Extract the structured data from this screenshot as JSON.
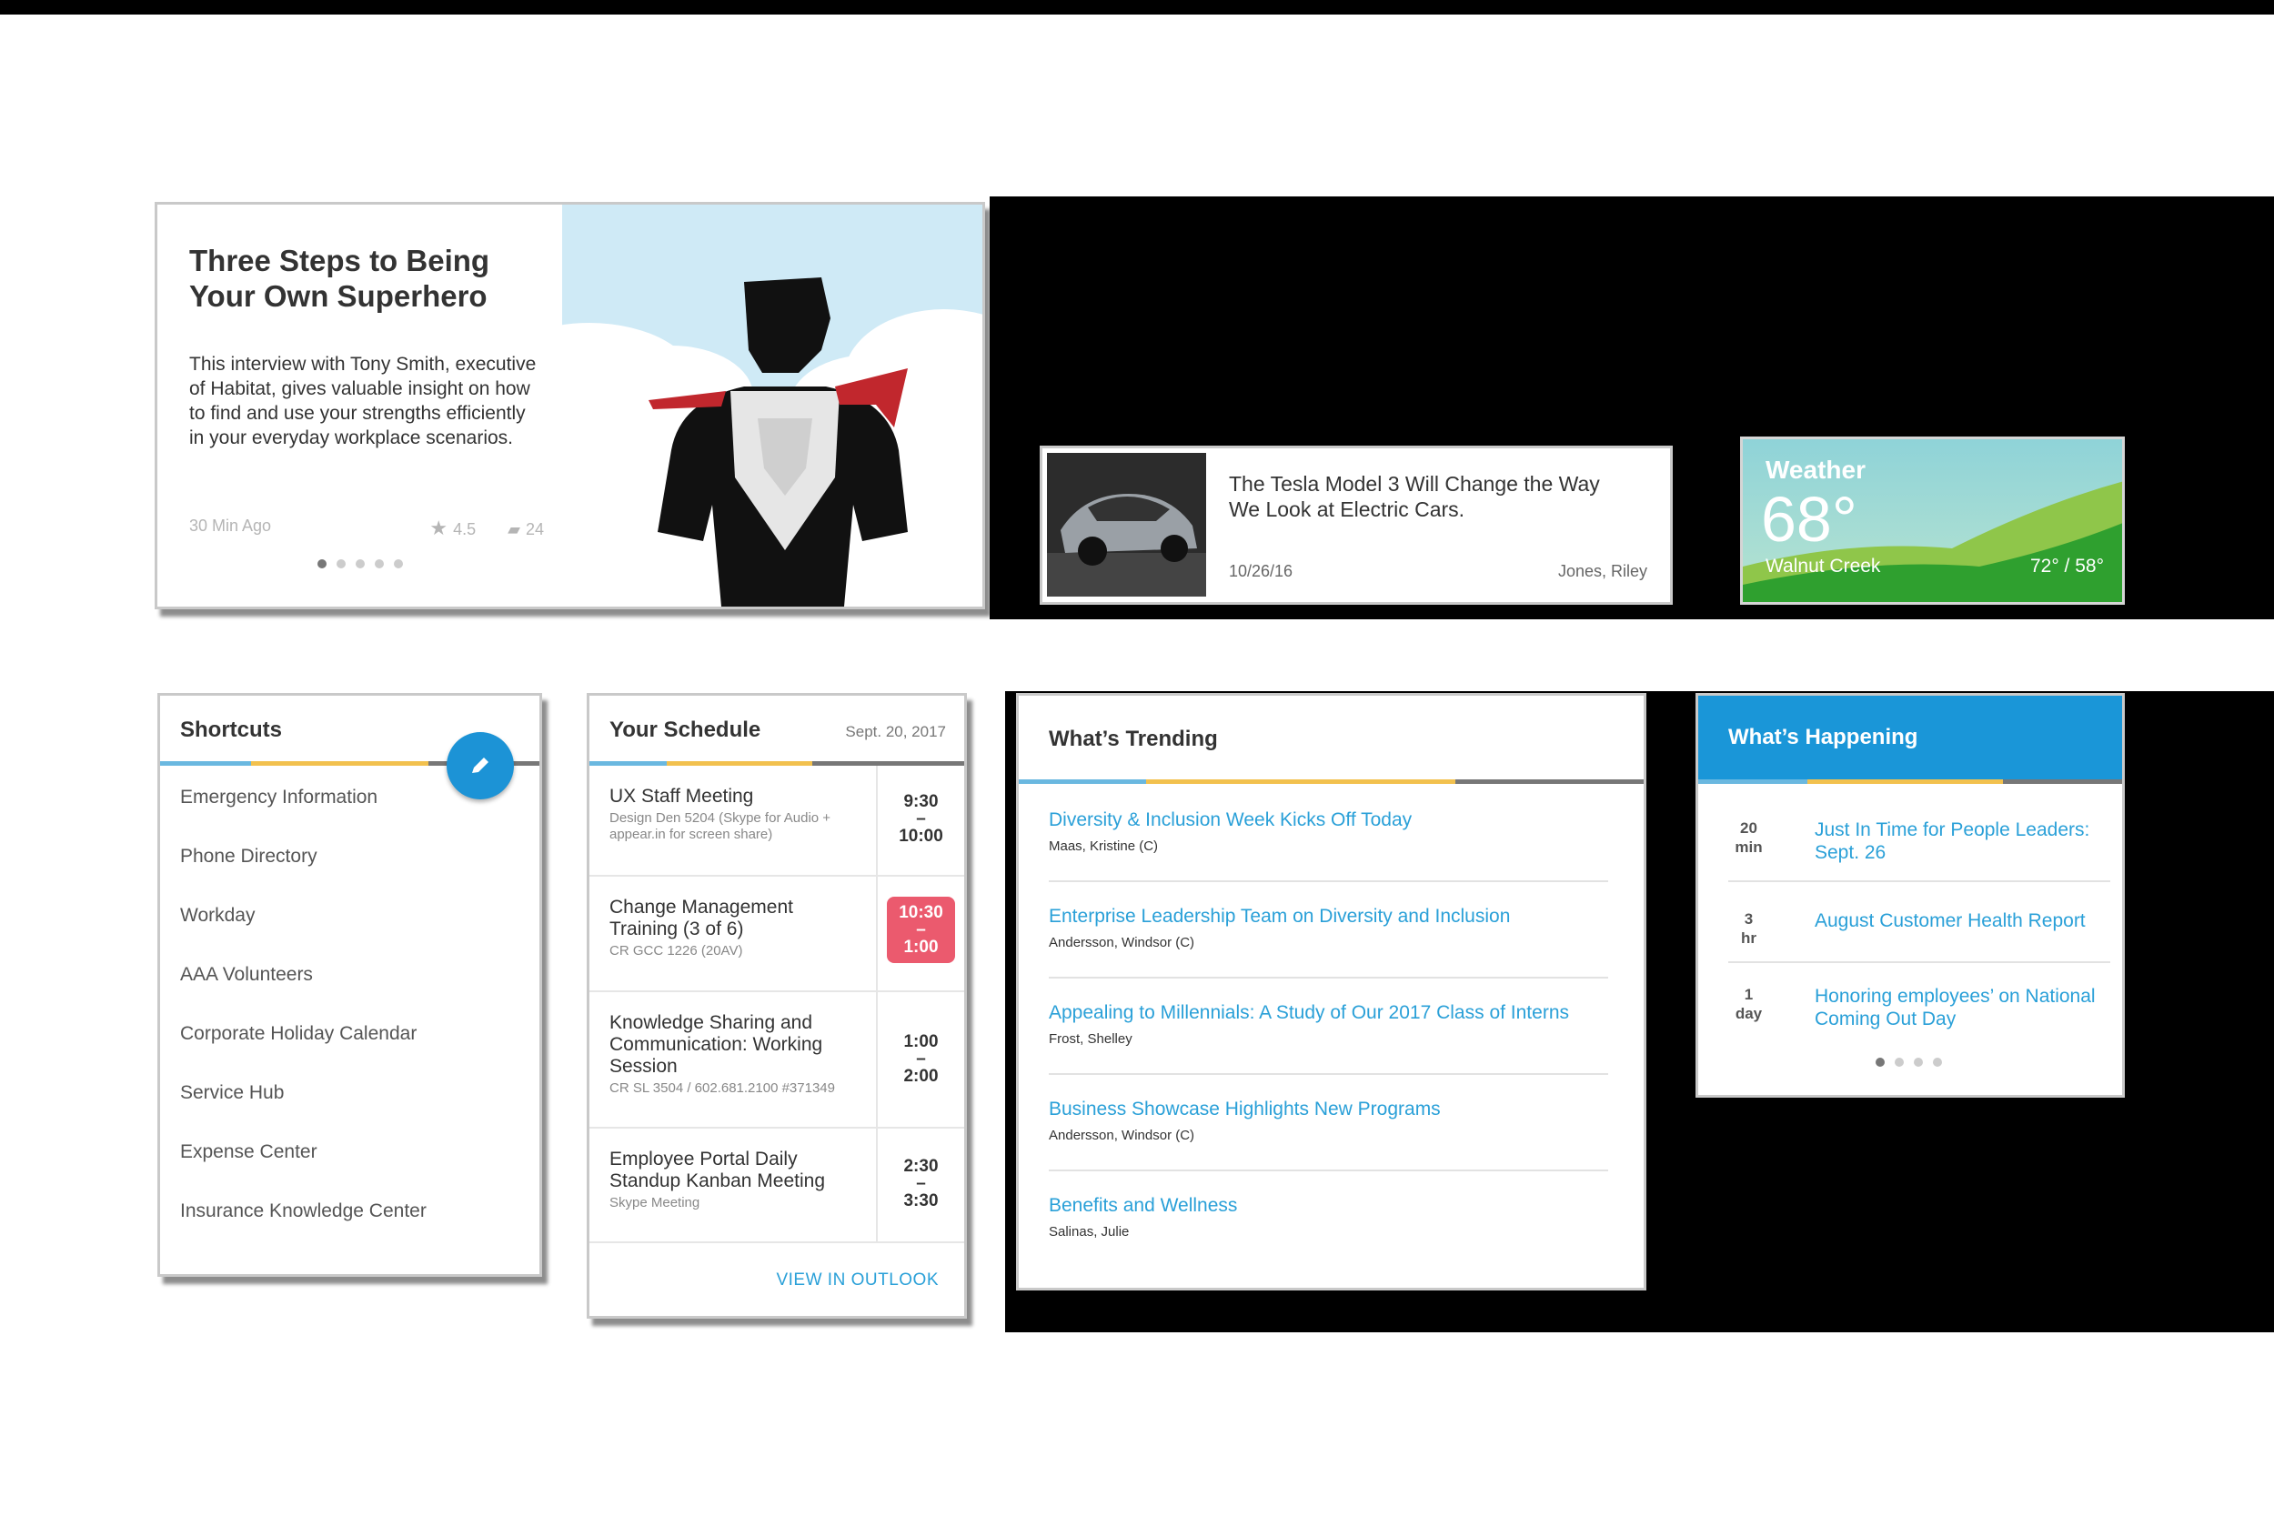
{
  "feature": {
    "title": "Three Steps to Being Your Own Superhero",
    "body": "This interview with Tony Smith, executive of Habitat, gives valuable insight on how to find and use your strengths efficiently in your everyday workplace scenarios.",
    "time_ago": "30 Min Ago",
    "rating": "4.5",
    "comments": "24",
    "carousel_dots": 5,
    "active_dot": 0
  },
  "tesla": {
    "title": "The Tesla Model 3 Will Change the Way We Look at Electric Cars.",
    "date": "10/26/16",
    "author": "Jones, Riley"
  },
  "weather": {
    "label": "Weather",
    "temp": "68°",
    "city": "Walnut Creek",
    "high_low": "72° / 58°"
  },
  "shortcuts": {
    "title": "Shortcuts",
    "items": [
      "Emergency Information",
      "Phone Directory",
      "Workday",
      "AAA Volunteers",
      "Corporate Holiday Calendar",
      "Service Hub",
      "Expense Center",
      "Insurance Knowledge Center"
    ]
  },
  "schedule": {
    "title": "Your Schedule",
    "date": "Sept. 20, 2017",
    "events": [
      {
        "title": "UX Staff Meeting",
        "sub": "Design Den 5204 (Skype for Audio + appear.in for screen share)",
        "start": "9:30",
        "sep": "–",
        "end": "10:00"
      },
      {
        "title": "Change Management Training (3 of 6)",
        "sub": "CR GCC 1226 (20AV)",
        "start": "10:30",
        "sep": "–",
        "end": "1:00"
      },
      {
        "title": "Knowledge Sharing and Communication: Working Session",
        "sub": "CR SL 3504 / 602.681.2100 #371349",
        "start": "1:00",
        "sep": "–",
        "end": "2:00"
      },
      {
        "title": "Employee Portal Daily Standup Kanban Meeting",
        "sub": "Skype Meeting",
        "start": "2:30",
        "sep": "–",
        "end": "3:30"
      }
    ],
    "view_link": "VIEW IN OUTLOOK"
  },
  "trending": {
    "title": "What’s Trending",
    "items": [
      {
        "headline": "Diversity & Inclusion Week Kicks Off Today",
        "author": "Maas, Kristine (C)"
      },
      {
        "headline": "Enterprise Leadership Team on Diversity and Inclusion",
        "author": "Andersson, Windsor (C)"
      },
      {
        "headline": "Appealing to Millennials: A Study of Our 2017 Class of Interns",
        "author": "Frost, Shelley"
      },
      {
        "headline": "Business Showcase Highlights New Programs",
        "author": "Andersson, Windsor (C)"
      },
      {
        "headline": "Benefits and Wellness",
        "author": "Salinas, Julie"
      }
    ]
  },
  "happening": {
    "title": "What’s Happening",
    "items": [
      {
        "num": "20",
        "unit": "min",
        "text": "Just In Time for People Leaders: Sept. 26"
      },
      {
        "num": "3",
        "unit": "hr",
        "text": "August Customer Health Report"
      },
      {
        "num": "1",
        "unit": "day",
        "text": "Honoring employees’ on National Coming Out Day"
      }
    ],
    "carousel_dots": 4,
    "active_dot": 0
  },
  "colors": {
    "accent_blue": "#1a96d8",
    "link": "#2aa0d8",
    "alert": "#eb5a6e",
    "bar_blue": "#6ab8e0",
    "bar_yellow": "#f2c14e",
    "bar_gray": "#777777"
  }
}
